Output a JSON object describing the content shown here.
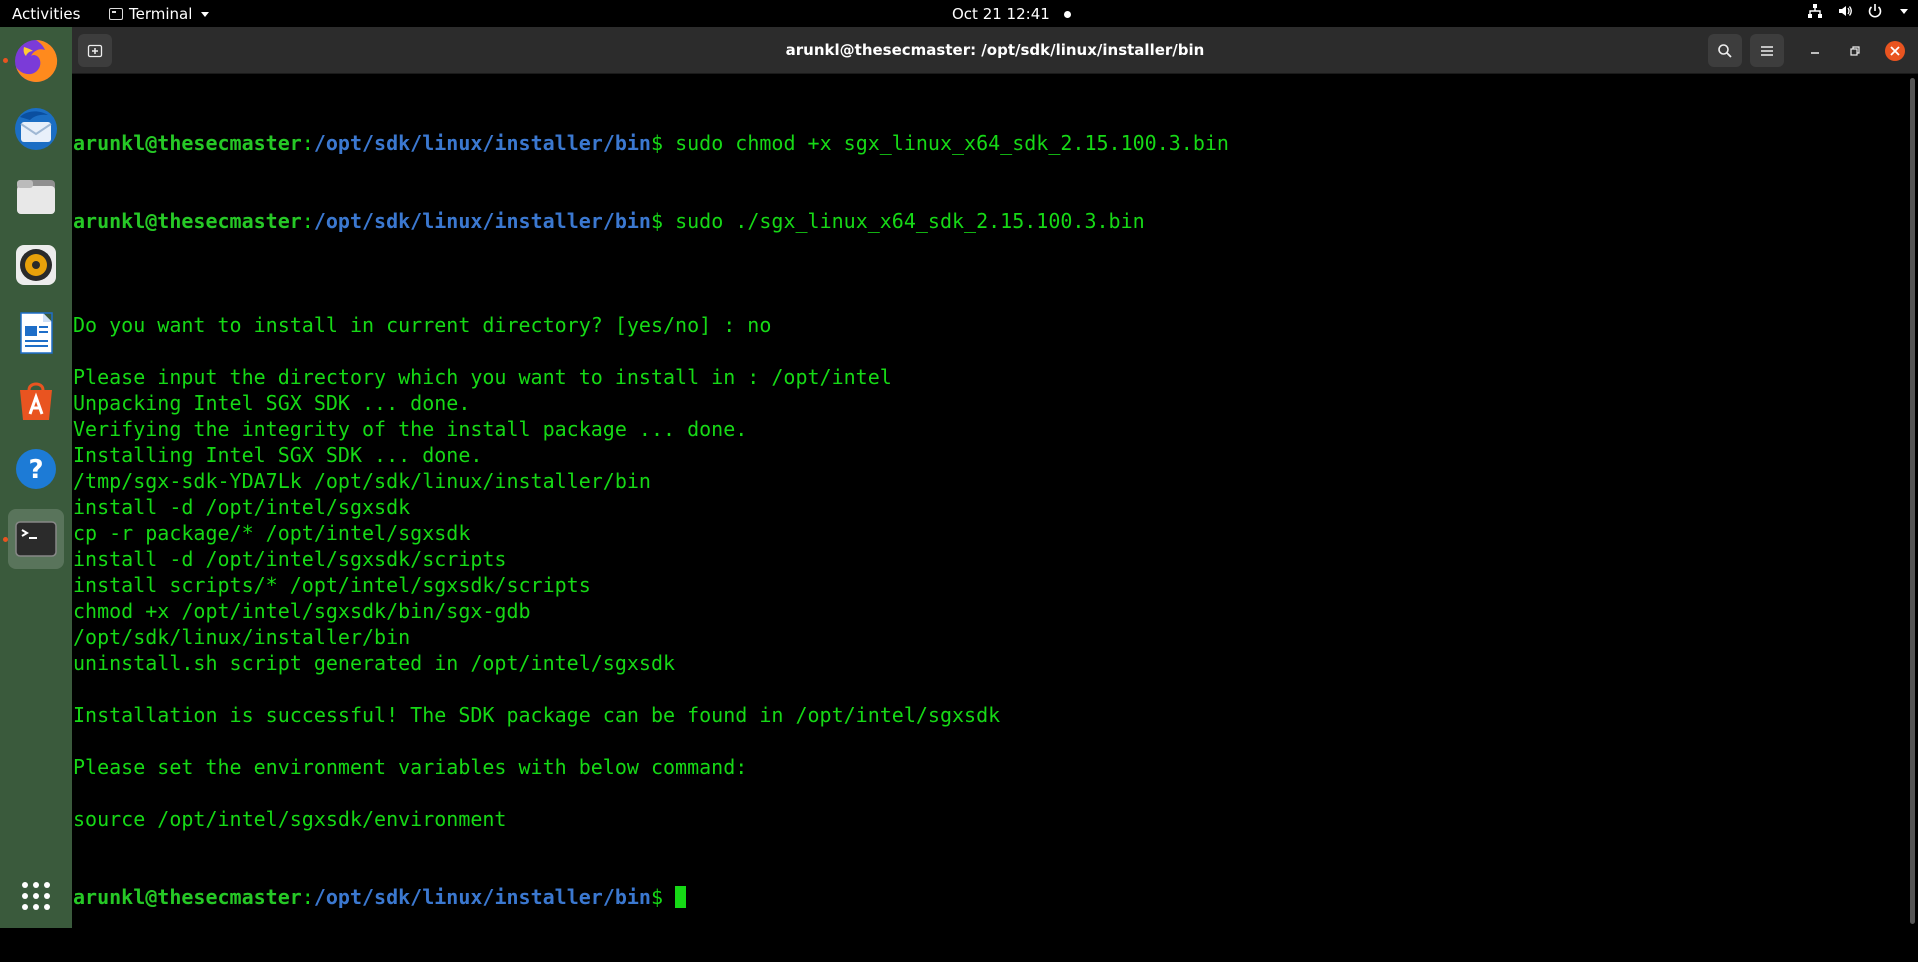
{
  "topbar": {
    "activities": "Activities",
    "app_name": "Terminal",
    "clock": "Oct 21  12:41"
  },
  "dock": {
    "apps": [
      "Firefox",
      "Thunderbird",
      "Files",
      "Rhythmbox",
      "LibreOffice Writer",
      "Ubuntu Software",
      "Help",
      "Terminal"
    ]
  },
  "window": {
    "title": "arunkl@thesecmaster: /opt/sdk/linux/installer/bin"
  },
  "terminal": {
    "prompt_user": "arunkl@thesecmaster",
    "prompt_sep": ":",
    "prompt_path": "/opt/sdk/linux/installer/bin",
    "prompt_end": "$",
    "cmd1": " sudo chmod +x sgx_linux_x64_sdk_2.15.100.3.bin",
    "cmd2": " sudo ./sgx_linux_x64_sdk_2.15.100.3.bin",
    "output": [
      "",
      "Do you want to install in current directory? [yes/no] : no",
      "",
      "Please input the directory which you want to install in : /opt/intel",
      "Unpacking Intel SGX SDK ... done.",
      "Verifying the integrity of the install package ... done.",
      "Installing Intel SGX SDK ... done.",
      "/tmp/sgx-sdk-YDA7Lk /opt/sdk/linux/installer/bin",
      "install -d /opt/intel/sgxsdk",
      "cp -r package/* /opt/intel/sgxsdk",
      "install -d /opt/intel/sgxsdk/scripts",
      "install scripts/* /opt/intel/sgxsdk/scripts",
      "chmod +x /opt/intel/sgxsdk/bin/sgx-gdb",
      "/opt/sdk/linux/installer/bin",
      "uninstall.sh script generated in /opt/intel/sgxsdk",
      "",
      "Installation is successful! The SDK package can be found in /opt/intel/sgxsdk",
      "",
      "Please set the environment variables with below command:",
      "",
      "source /opt/intel/sgxsdk/environment"
    ]
  },
  "colors": {
    "terminal_text": "#16d916",
    "prompt_user": "#26c826",
    "prompt_path": "#3b78d0",
    "dock_bg": "#3a5a3c",
    "headerbar_bg": "#2c2c2c",
    "close_button": "#e95420"
  }
}
